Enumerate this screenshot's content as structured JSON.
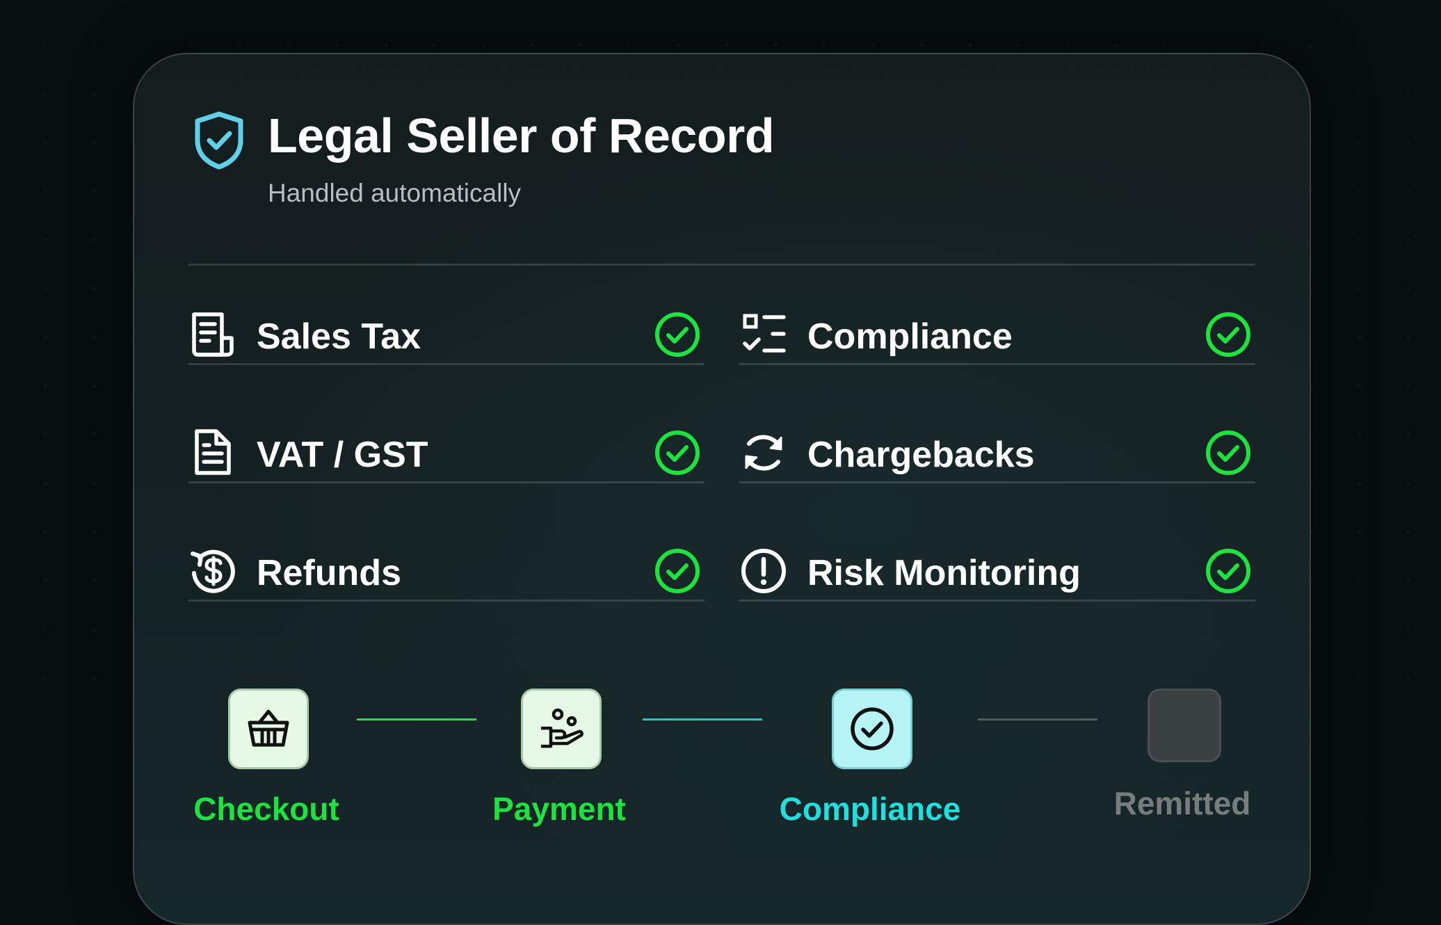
{
  "header": {
    "title": "Legal Seller of Record",
    "subtitle": "Handled automatically",
    "icon": "shield-check-icon"
  },
  "colors": {
    "accent_green": "#1ee33f",
    "accent_cyan": "#1ee0e0",
    "muted_gray": "#777c7c",
    "shield_blue": "#5fd0e8"
  },
  "features": [
    {
      "label": "Sales Tax",
      "icon": "receipt-icon",
      "status": "checked"
    },
    {
      "label": "Compliance",
      "icon": "checklist-icon",
      "status": "checked"
    },
    {
      "label": "VAT / GST",
      "icon": "document-icon",
      "status": "checked"
    },
    {
      "label": "Chargebacks",
      "icon": "refresh-icon",
      "status": "checked"
    },
    {
      "label": "Refunds",
      "icon": "dollar-refund-icon",
      "status": "checked"
    },
    {
      "label": "Risk Monitoring",
      "icon": "alert-circle-icon",
      "status": "checked"
    }
  ],
  "steps": [
    {
      "label": "Checkout",
      "icon": "basket-icon",
      "state": "done"
    },
    {
      "label": "Payment",
      "icon": "hand-coins-icon",
      "state": "done"
    },
    {
      "label": "Compliance",
      "icon": "check-circle-icon",
      "state": "active"
    },
    {
      "label": "Remitted",
      "icon": "empty-box",
      "state": "pending"
    }
  ]
}
